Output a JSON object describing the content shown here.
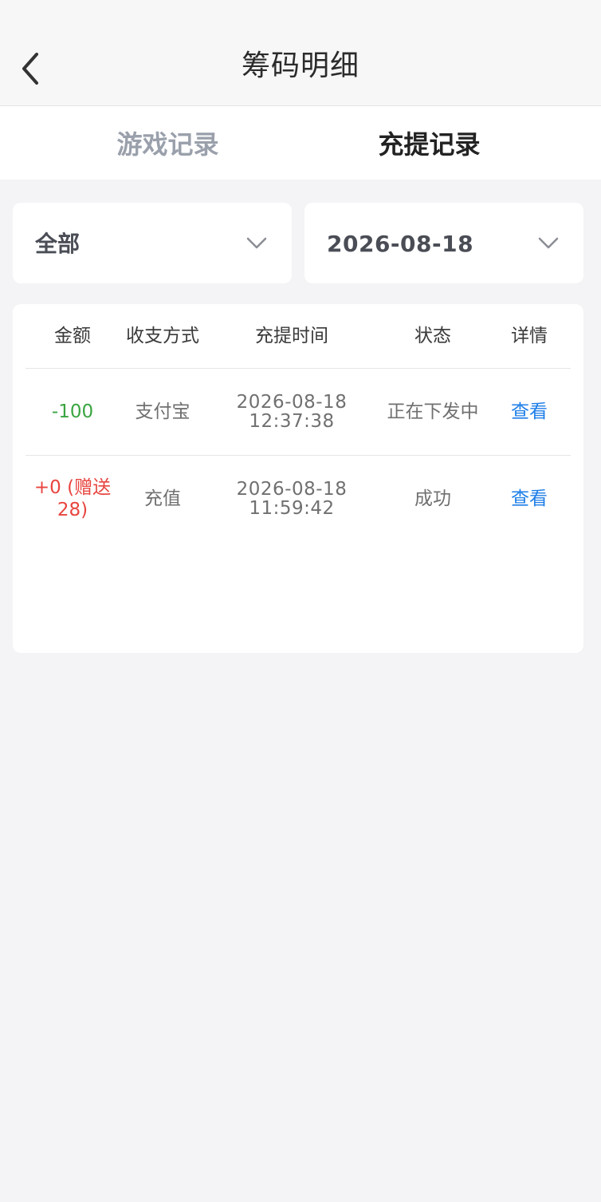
{
  "header": {
    "title": "筹码明细",
    "back_icon": "chevron-left-icon"
  },
  "tabs": [
    {
      "label": "游戏记录",
      "active": false
    },
    {
      "label": "充提记录",
      "active": true
    }
  ],
  "filters": {
    "type": {
      "value": "全部",
      "icon": "chevron-down-icon"
    },
    "date": {
      "value": "2026-08-18",
      "icon": "chevron-down-icon"
    }
  },
  "table": {
    "columns": [
      "金额",
      "收支方式",
      "充提时间",
      "状态",
      "详情"
    ],
    "rows": [
      {
        "amount": "-100",
        "method": "支付宝",
        "date": "2026-08-18",
        "time": "12:37:38",
        "status": "正在下发中",
        "detail": "查看"
      },
      {
        "amount_line1": "+0 (赠送",
        "amount_line2": "28)",
        "method": "充值",
        "date": "2026-08-18",
        "time": "11:59:42",
        "status": "成功",
        "detail": "查看"
      }
    ]
  },
  "colors": {
    "negative_amount": "#3aa541",
    "positive_amount": "#e8453f",
    "link": "#1e7ee8",
    "inactive_tab": "#9aa0ab"
  }
}
